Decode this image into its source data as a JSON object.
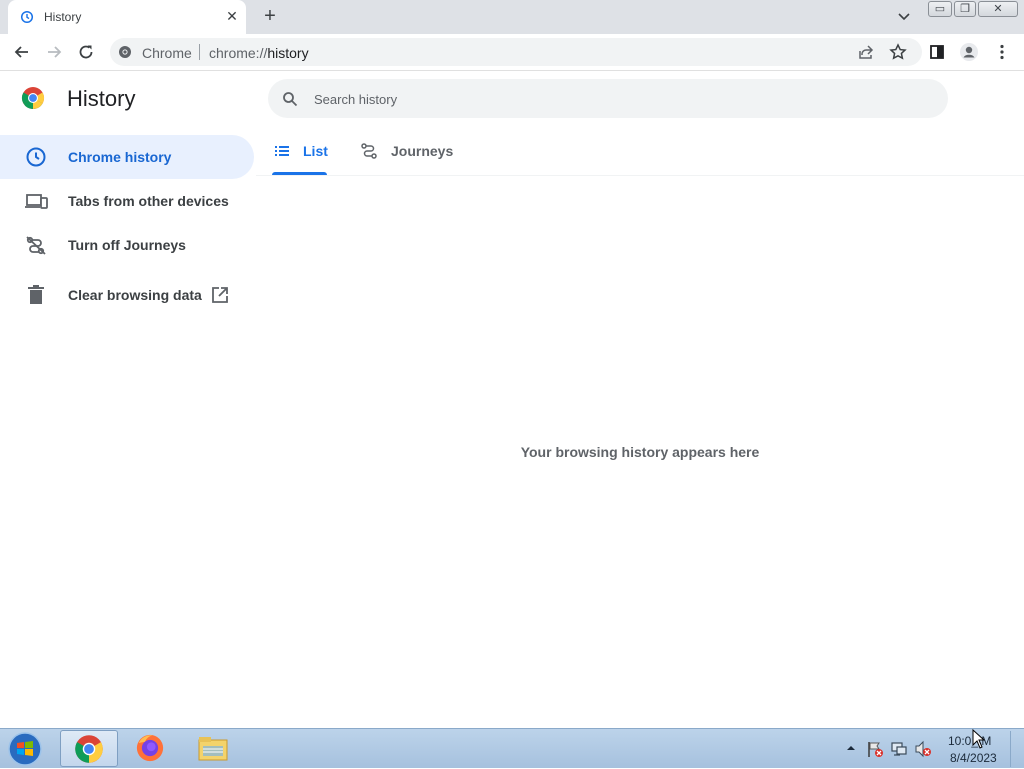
{
  "browser": {
    "tab_title": "History",
    "tab_close_glyph": "✕",
    "new_tab_glyph": "+",
    "window_controls": {
      "minimize": "▭",
      "restore": "❐",
      "close": "✕"
    },
    "omnibox": {
      "site_label": "Chrome",
      "url_scheme": "chrome://",
      "url_path": "history"
    }
  },
  "history_page": {
    "title": "History",
    "search": {
      "placeholder": "Search history",
      "value": ""
    },
    "sidebar": {
      "items": [
        {
          "label": "Chrome history",
          "icon": "clock-icon",
          "active": true
        },
        {
          "label": "Tabs from other devices",
          "icon": "devices-icon",
          "active": false
        },
        {
          "label": "Turn off Journeys",
          "icon": "journeys-off-icon",
          "active": false
        },
        {
          "label": "Clear browsing data",
          "icon": "trash-icon",
          "active": false,
          "trailing_icon": "external-link-icon"
        }
      ]
    },
    "tabs": [
      {
        "label": "List",
        "icon": "list-icon",
        "selected": true
      },
      {
        "label": "Journeys",
        "icon": "journeys-icon",
        "selected": false
      }
    ],
    "empty_message": "Your browsing history appears here"
  },
  "taskbar": {
    "items": [
      "chrome-icon",
      "firefox-icon",
      "file-explorer-icon"
    ],
    "clock": {
      "time": "10:0_ M",
      "date": "8/4/2023"
    }
  },
  "colors": {
    "accent": "#1a73e8",
    "active_nav_bg": "#e8f0fe",
    "tabstrip_bg": "#dee1e6",
    "taskbar_bg": "#b4cce6"
  }
}
